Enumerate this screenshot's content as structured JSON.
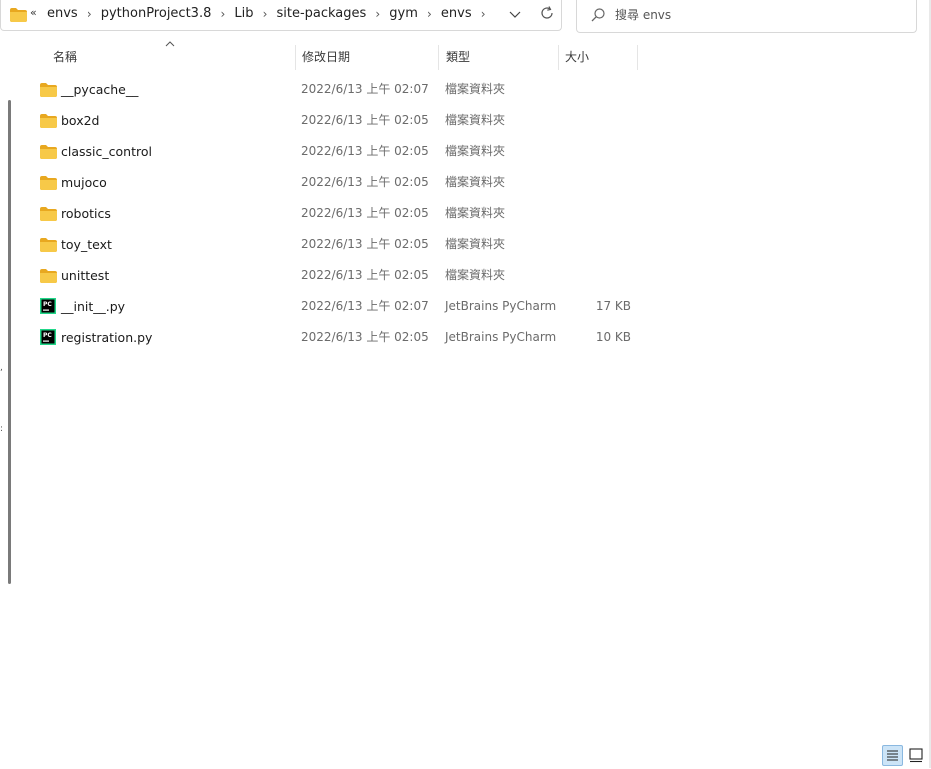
{
  "address": {
    "overflow_glyph": "«",
    "crumbs": [
      "envs",
      "pythonProject3.8",
      "Lib",
      "site-packages",
      "gym",
      "envs"
    ],
    "separator": "›"
  },
  "search": {
    "placeholder": "搜尋 envs"
  },
  "columns": {
    "name": "名稱",
    "date": "修改日期",
    "type": "類型",
    "size": "大小"
  },
  "files": [
    {
      "name": "__pycache__",
      "date": "2022/6/13 上午 02:07",
      "type": "檔案資料夾",
      "size": "",
      "icon": "folder-icon"
    },
    {
      "name": "box2d",
      "date": "2022/6/13 上午 02:05",
      "type": "檔案資料夾",
      "size": "",
      "icon": "folder-icon"
    },
    {
      "name": "classic_control",
      "date": "2022/6/13 上午 02:05",
      "type": "檔案資料夾",
      "size": "",
      "icon": "folder-icon"
    },
    {
      "name": "mujoco",
      "date": "2022/6/13 上午 02:05",
      "type": "檔案資料夾",
      "size": "",
      "icon": "folder-icon"
    },
    {
      "name": "robotics",
      "date": "2022/6/13 上午 02:05",
      "type": "檔案資料夾",
      "size": "",
      "icon": "folder-icon"
    },
    {
      "name": "toy_text",
      "date": "2022/6/13 上午 02:05",
      "type": "檔案資料夾",
      "size": "",
      "icon": "folder-icon"
    },
    {
      "name": "unittest",
      "date": "2022/6/13 上午 02:05",
      "type": "檔案資料夾",
      "size": "",
      "icon": "folder-icon"
    },
    {
      "name": "__init__.py",
      "date": "2022/6/13 上午 02:07",
      "type": "JetBrains PyCharm",
      "size": "17 KB",
      "icon": "pycharm-file-icon"
    },
    {
      "name": "registration.py",
      "date": "2022/6/13 上午 02:05",
      "type": "JetBrains PyCharm",
      "size": "10 KB",
      "icon": "pycharm-file-icon"
    }
  ],
  "colors": {
    "folder": "#f7c948",
    "folder_dark": "#e8a820",
    "accent": "#0067c0",
    "pycharm_bg": "#000000",
    "pycharm_fg": "#21d789"
  }
}
